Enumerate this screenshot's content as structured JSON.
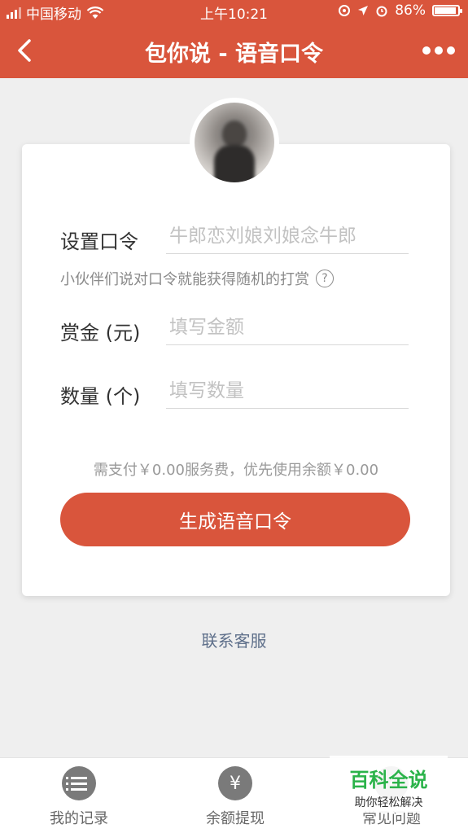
{
  "status": {
    "carrier": "中国移动",
    "time": "上午10:21",
    "battery": "86%",
    "battery_level": 0.86
  },
  "nav": {
    "title": "包你说 - 语音口令",
    "back_icon": "chevron-left-icon",
    "more_icon": "more-dots-icon"
  },
  "form": {
    "command": {
      "label": "设置口令",
      "placeholder": "牛郎恋刘娘刘娘念牛郎"
    },
    "hint": "小伙伴们说对口令就能获得随机的打赏",
    "amount": {
      "label": "赏金 (元)",
      "placeholder": "填写金额"
    },
    "quantity": {
      "label": "数量 (个)",
      "placeholder": "填写数量"
    },
    "fee_text": "需支付￥0.00服务费，优先使用余额￥0.00",
    "submit_label": "生成语音口令"
  },
  "contact_label": "联系客服",
  "tabbar": {
    "records": {
      "label": "我的记录",
      "icon": "list-icon"
    },
    "withdraw": {
      "label": "余额提现",
      "icon": "yen-icon"
    },
    "faq": {
      "label": "常见问题",
      "icon": "question-icon"
    }
  },
  "watermark": {
    "title": "百科全说",
    "subtitle": "助你轻松解决"
  },
  "colors": {
    "brand": "#d9553c",
    "link": "#5e6f8a",
    "watermark": "#2bb34a"
  }
}
